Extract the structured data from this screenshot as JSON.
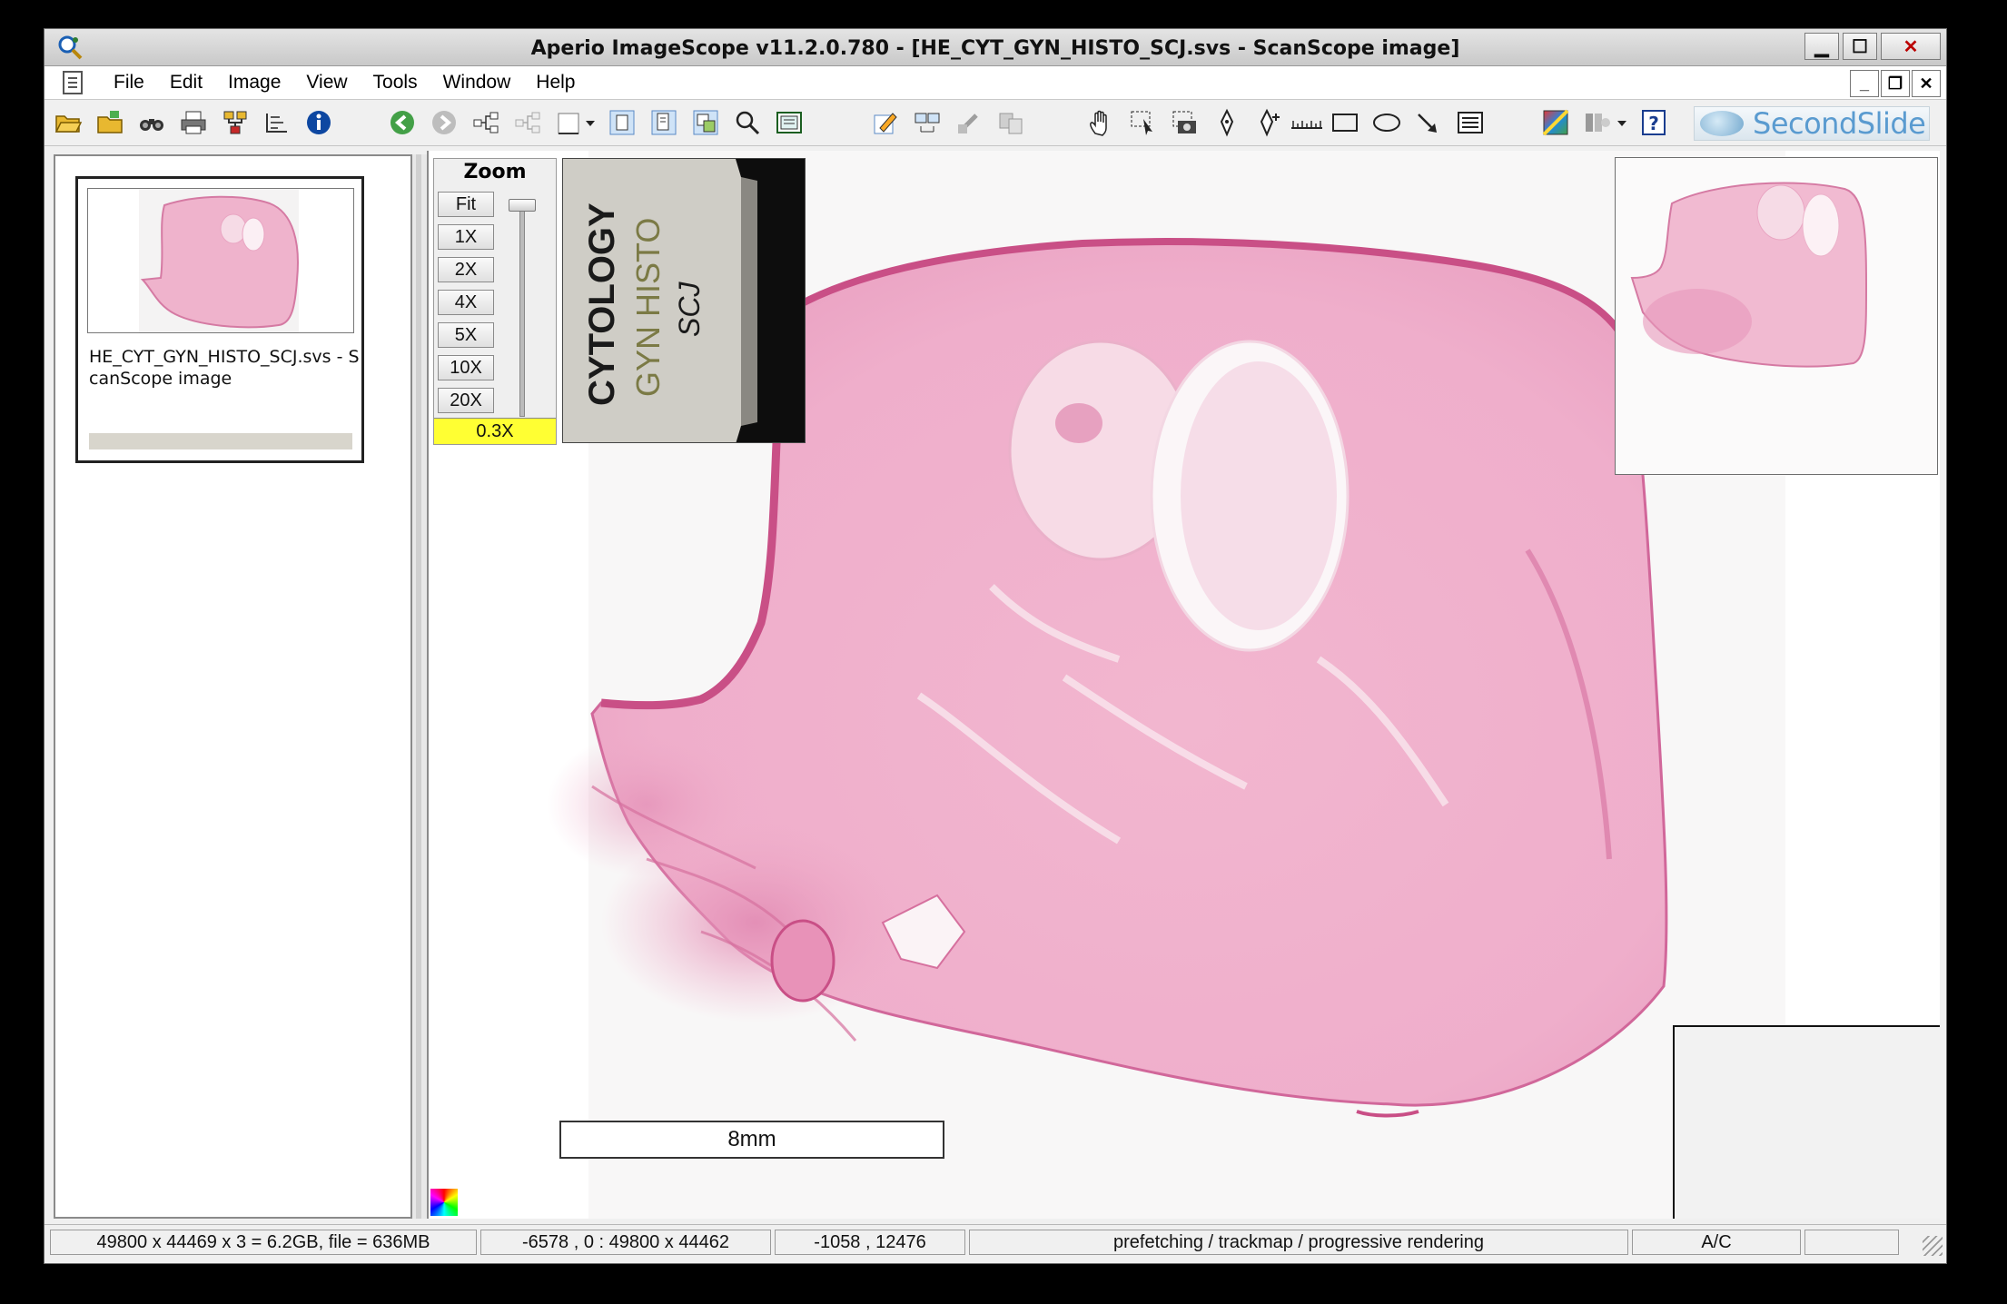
{
  "window": {
    "title": "Aperio ImageScope v11.2.0.780  - [HE_CYT_GYN_HISTO_SCJ.svs - ScanScope image]",
    "buttons": {
      "minimize": "▁",
      "maximize": "☐",
      "close": "✕"
    }
  },
  "menubar": {
    "items": [
      "File",
      "Edit",
      "Image",
      "View",
      "Tools",
      "Window",
      "Help"
    ],
    "mdi_buttons": {
      "minimize": "_",
      "restore": "❐",
      "close": "✕"
    }
  },
  "toolbar": {
    "icons": [
      "open-folder-icon",
      "open-icon",
      "binoculars-icon",
      "print-icon",
      "network-icon",
      "layers-icon",
      "info-icon",
      "back-icon",
      "forward-icon",
      "tree-icon",
      "tree-disabled-icon",
      "rect-select-icon",
      "dropdown-icon",
      "frame-icon",
      "file-info-icon",
      "overview-toggle-icon",
      "magnify-icon",
      "panel-icon",
      "annotate-icon",
      "compare-icon",
      "link-icon",
      "sync-icon",
      "pan-hand-icon",
      "select-arrow-icon",
      "capture-icon",
      "pen-icon",
      "pen-plus-icon",
      "ruler-icon",
      "rectangle-icon",
      "ellipse-icon",
      "arrow-icon",
      "list-icon",
      "color-icon",
      "brightness-icon",
      "dropdown-icon",
      "help-icon"
    ],
    "brand": "SecondSlide"
  },
  "thumbnail": {
    "caption": "HE_CYT_GYN_HISTO_SCJ.svs - ScanScope image"
  },
  "zoom": {
    "title": "Zoom",
    "buttons": [
      "Fit",
      "1X",
      "2X",
      "4X",
      "5X",
      "10X",
      "20X"
    ],
    "current": "0.3X"
  },
  "label": {
    "line1": "CYTOLOGY",
    "line2": "GYN HISTO",
    "line3": "SCJ"
  },
  "scalebar": {
    "text": "8mm"
  },
  "status": {
    "dimensions": "49800 x 44469 x 3 = 6.2GB, file = 636MB",
    "region": "-6578 , 0 : 49800 x 44462",
    "cursor": "-1058 , 12476",
    "mode": "prefetching / trackmap / progressive rendering",
    "ac": "A/C",
    "extra": ""
  },
  "colors": {
    "tissue": "#e58fb4",
    "tissue_edge": "#c94f86",
    "zoom_highlight": "#ffff33",
    "brand": "#5a9bd0"
  }
}
